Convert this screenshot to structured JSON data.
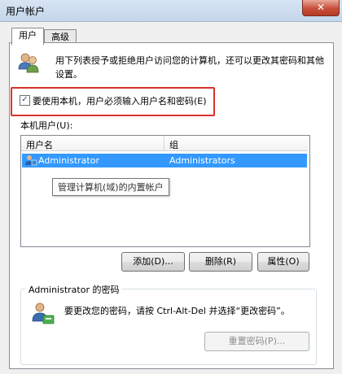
{
  "window": {
    "title": "用户帐户",
    "close_glyph": "✕"
  },
  "tabs": [
    {
      "label": "用户",
      "active": true
    },
    {
      "label": "高级",
      "active": false
    }
  ],
  "description": "用下列表授予或拒绝用户访问您的计算机，还可以更改其密码和其他设置。",
  "require_login": {
    "label": "要使用本机，用户必须输入用户名和密码(E)",
    "checked": true,
    "check_glyph": "✓"
  },
  "users_section": {
    "label": "本机用户(U):",
    "columns": [
      "用户名",
      "组"
    ],
    "rows": [
      {
        "name": "Administrator",
        "group": "Administrators",
        "selected": true
      }
    ],
    "tooltip": "管理计算机(域)的内置帐户"
  },
  "buttons": {
    "add": "添加(D)...",
    "delete": "删除(R)",
    "properties": "属性(O)"
  },
  "password_group": {
    "title": "Administrator 的密码",
    "text": "要更改您的密码，请按 Ctrl-Alt-Del 并选择“更改密码”。",
    "reset_button": "重置密码(P)..."
  },
  "colors": {
    "selection": "#3399ff",
    "highlight_border": "#d8332e",
    "close_button": "#c94f3b"
  }
}
